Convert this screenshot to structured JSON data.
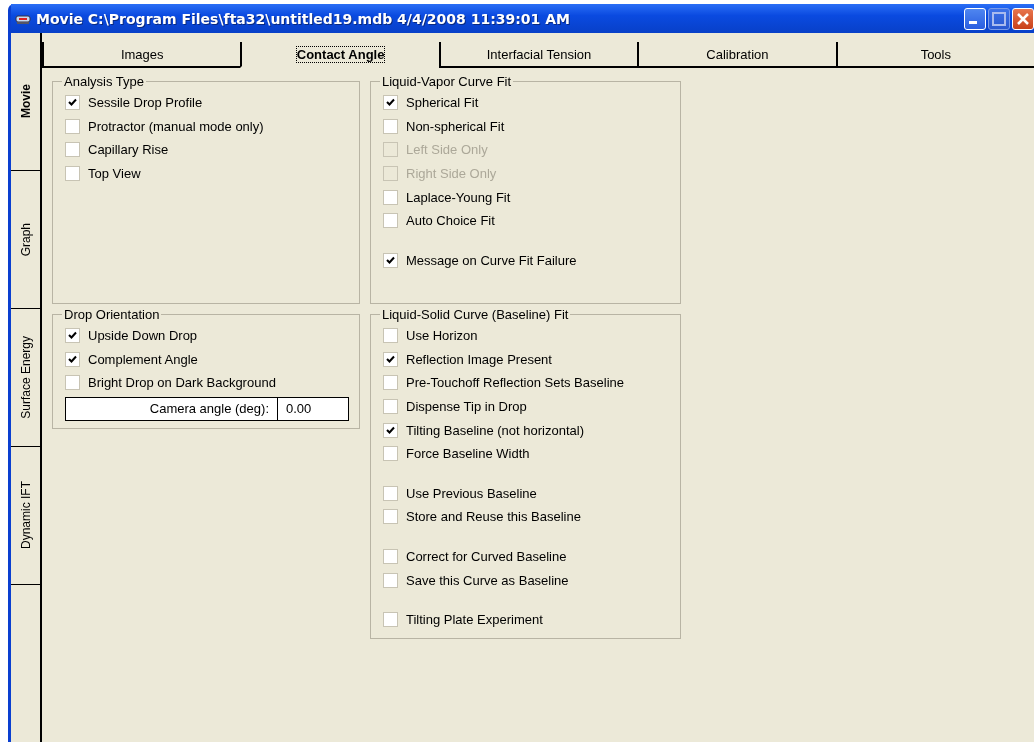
{
  "window": {
    "title": "Movie C:\\Program Files\\fta32\\untitled19.mdb 4/4/2008 11:39:01 AM"
  },
  "side_tabs": [
    {
      "label": "Movie",
      "selected": true
    },
    {
      "label": "Graph",
      "selected": false
    },
    {
      "label": "Surface Energy",
      "selected": false
    },
    {
      "label": "Dynamic IFT",
      "selected": false
    }
  ],
  "tabs": [
    {
      "label": "Images",
      "selected": false
    },
    {
      "label": "Contact Angle",
      "selected": true
    },
    {
      "label": "Interfacial Tension",
      "selected": false
    },
    {
      "label": "Calibration",
      "selected": false
    },
    {
      "label": "Tools",
      "selected": false
    }
  ],
  "columns": [
    [
      {
        "title": "Analysis Type",
        "groups": [
          [
            {
              "label": "Sessile Drop Profile",
              "checked": true,
              "disabled": false
            },
            {
              "label": "Protractor (manual mode only)",
              "checked": false,
              "disabled": false
            },
            {
              "label": "Capillary Rise",
              "checked": false,
              "disabled": false
            },
            {
              "label": "Top View",
              "checked": false,
              "disabled": false
            }
          ]
        ]
      },
      {
        "title": "Drop Orientation",
        "groups": [
          [
            {
              "label": "Upside Down Drop",
              "checked": true,
              "disabled": false
            },
            {
              "label": "Complement Angle",
              "checked": true,
              "disabled": false
            },
            {
              "label": "Bright Drop on Dark Background",
              "checked": false,
              "disabled": false
            }
          ]
        ],
        "field": {
          "label": "Camera angle (deg):",
          "value": "0.00"
        }
      }
    ],
    [
      {
        "title": "Liquid-Vapor Curve Fit",
        "groups": [
          [
            {
              "label": "Spherical Fit",
              "checked": true,
              "disabled": false
            },
            {
              "label": "Non-spherical Fit",
              "checked": false,
              "disabled": false
            },
            {
              "label": "Left Side Only",
              "checked": false,
              "disabled": true
            },
            {
              "label": "Right Side Only",
              "checked": false,
              "disabled": true
            },
            {
              "label": "Laplace-Young Fit",
              "checked": false,
              "disabled": false
            },
            {
              "label": "Auto Choice Fit",
              "checked": false,
              "disabled": false
            }
          ],
          [
            {
              "label": "Message on Curve Fit Failure",
              "checked": true,
              "disabled": false
            }
          ]
        ]
      },
      {
        "title": "Liquid-Solid Curve (Baseline) Fit",
        "groups": [
          [
            {
              "label": "Use Horizon",
              "checked": false,
              "disabled": false
            },
            {
              "label": "Reflection Image Present",
              "checked": true,
              "disabled": false
            },
            {
              "label": "Pre-Touchoff Reflection Sets Baseline",
              "checked": false,
              "disabled": false
            },
            {
              "label": "Dispense Tip in Drop",
              "checked": false,
              "disabled": false
            },
            {
              "label": "Tilting Baseline (not horizontal)",
              "checked": true,
              "disabled": false
            },
            {
              "label": "Force Baseline Width",
              "checked": false,
              "disabled": false
            }
          ],
          [
            {
              "label": "Use Previous Baseline",
              "checked": false,
              "disabled": false
            },
            {
              "label": "Store and Reuse this Baseline",
              "checked": false,
              "disabled": false
            }
          ],
          [
            {
              "label": "Correct for Curved Baseline",
              "checked": false,
              "disabled": false
            },
            {
              "label": "Save this Curve as Baseline",
              "checked": false,
              "disabled": false
            }
          ],
          [
            {
              "label": "Tilting Plate Experiment",
              "checked": false,
              "disabled": false
            }
          ]
        ]
      }
    ]
  ]
}
